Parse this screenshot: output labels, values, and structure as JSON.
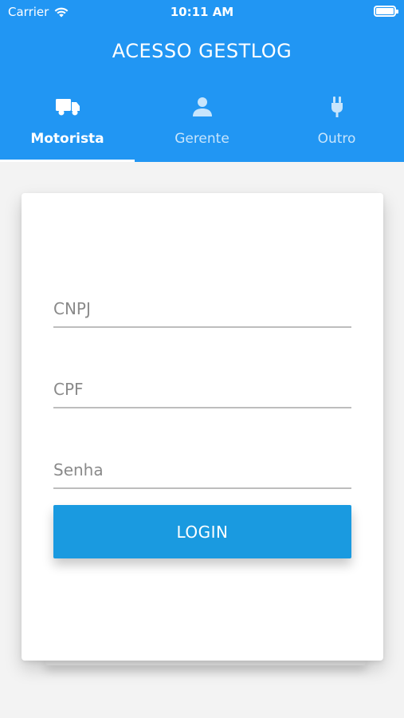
{
  "status_bar": {
    "carrier": "Carrier",
    "time": "10:11 AM"
  },
  "header": {
    "title": "ACESSO GESTLOG",
    "background_color": "#2196f3"
  },
  "tabs": [
    {
      "label": "Motorista",
      "icon": "truck-icon",
      "active": true
    },
    {
      "label": "Gerente",
      "icon": "person-icon",
      "active": false
    },
    {
      "label": "Outro",
      "icon": "plug-icon",
      "active": false
    }
  ],
  "form": {
    "cnpj": {
      "placeholder": "CNPJ",
      "value": ""
    },
    "cpf": {
      "placeholder": "CPF",
      "value": ""
    },
    "senha": {
      "placeholder": "Senha",
      "value": ""
    },
    "login_label": "LOGIN",
    "login_color": "#1a9ae0"
  }
}
